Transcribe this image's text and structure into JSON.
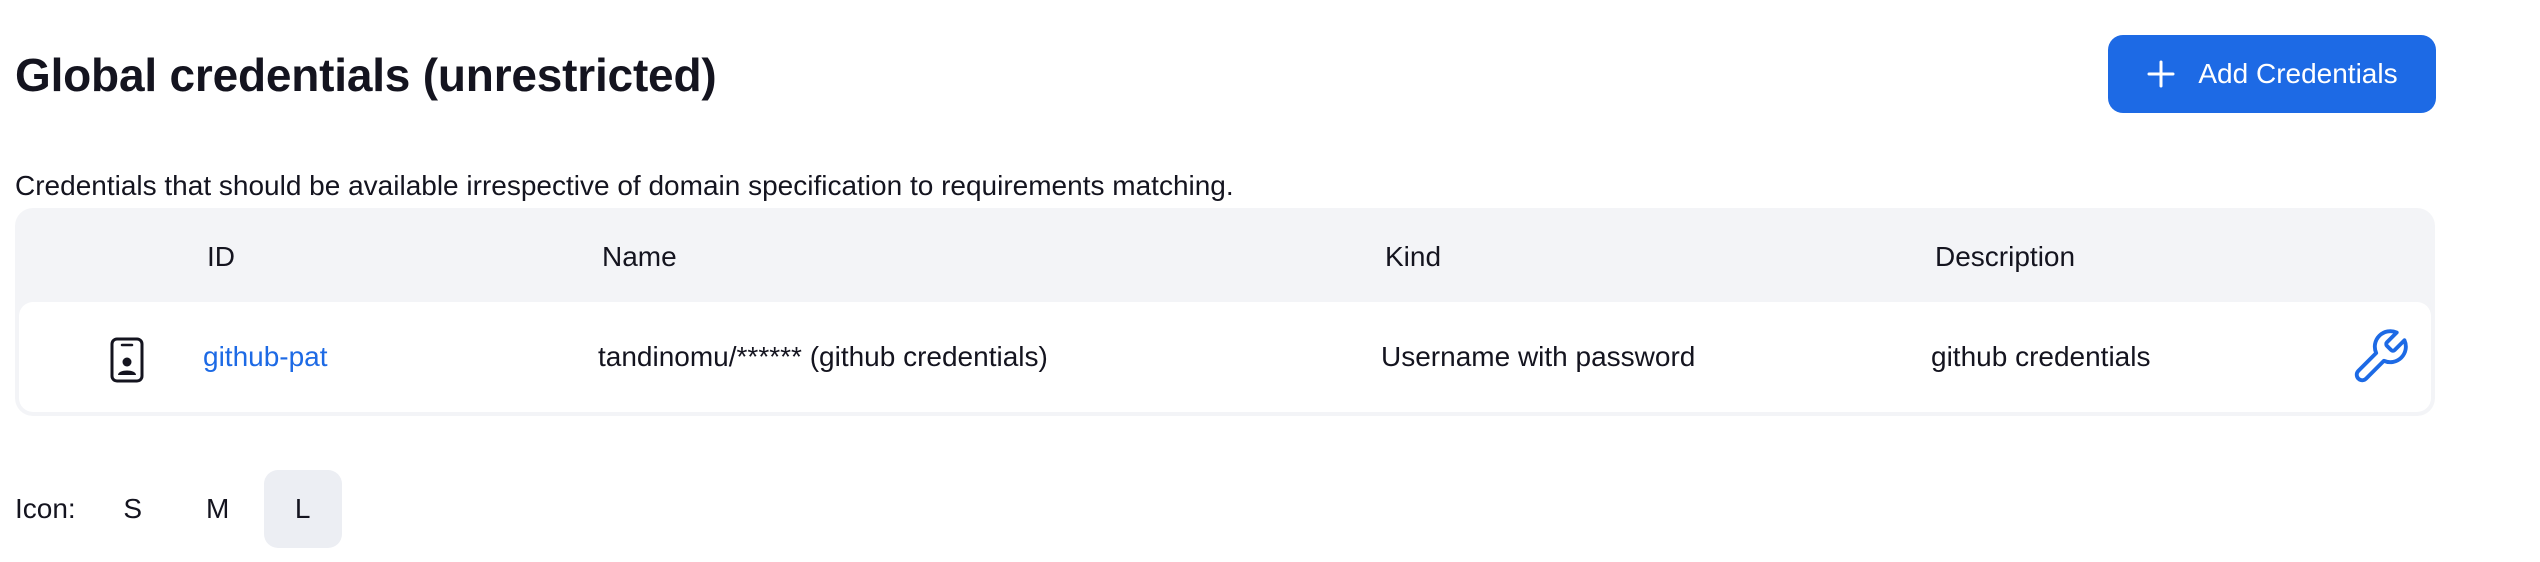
{
  "header": {
    "title": "Global credentials (unrestricted)",
    "add_button_label": "Add Credentials"
  },
  "description": "Credentials that should be available irrespective of domain specification to requirements matching.",
  "table": {
    "columns": [
      "",
      "ID",
      "Name",
      "Kind",
      "Description"
    ],
    "rows": [
      {
        "icon": "id-card-icon",
        "id": "github-pat",
        "name": "tandinomu/****** (github credentials)",
        "kind": "Username with password",
        "description": "github credentials",
        "action_icon": "wrench-icon"
      }
    ]
  },
  "icon_size": {
    "label": "Icon:",
    "options": [
      "S",
      "M",
      "L"
    ],
    "selected": "L"
  },
  "colors": {
    "accent": "#1d6ae5",
    "table_bg": "#f3f4f7",
    "selected_bg": "#eceef3"
  }
}
